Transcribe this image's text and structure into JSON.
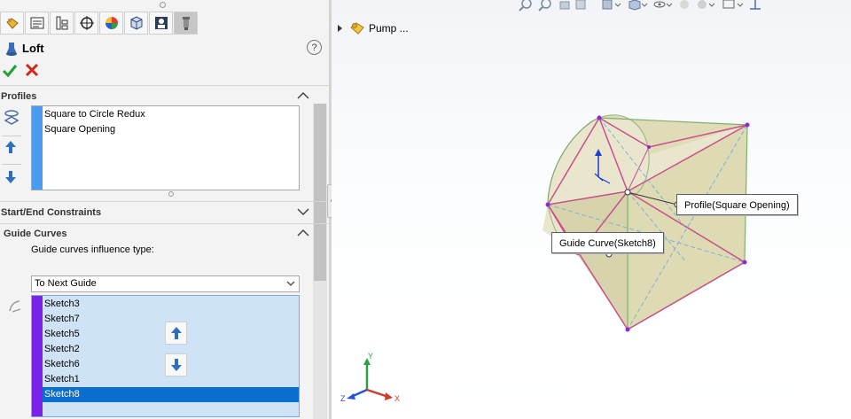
{
  "panel": {
    "title": "Loft",
    "help_label": "?",
    "tabs": [
      "feature-manager-icon",
      "property-manager-icon",
      "configuration-manager-icon",
      "dimxpert-icon",
      "display-manager-icon",
      "cam-icon",
      "simulation-icon",
      "loft-tool-icon"
    ],
    "profiles": {
      "title": "Profiles",
      "items": [
        "Square to Circle Redux",
        "Square Opening"
      ]
    },
    "constraints": {
      "title": "Start/End Constraints"
    },
    "guide_curves": {
      "title": "Guide Curves",
      "influence_label": "Guide curves influence type:",
      "influence_value": "To Next Guide",
      "items": [
        "Sketch3",
        "Sketch7",
        "Sketch5",
        "Sketch2",
        "Sketch6",
        "Sketch1",
        "Sketch8"
      ],
      "selected": "Sketch8"
    }
  },
  "viewport": {
    "tree_item": "Pump ...",
    "callouts": {
      "profile": "Profile(Square Opening)",
      "guide": "Guide Curve(Sketch8)"
    },
    "triad": {
      "y": "Y",
      "x": "X",
      "z": "Z"
    }
  },
  "colors": {
    "profile_bar": "#4a9cf0",
    "guide_bar": "#7a22e6",
    "selection": "#0a6ed1",
    "ok": "#21a038",
    "cancel": "#d4251c"
  }
}
